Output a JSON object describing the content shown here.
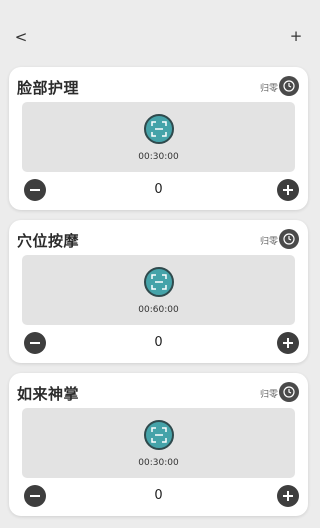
{
  "nav": {
    "back_label": "<",
    "add_label": "+"
  },
  "cards": [
    {
      "title": "脸部护理",
      "reset_label": "归零",
      "time": "00:30:00",
      "count": "0"
    },
    {
      "title": "穴位按摩",
      "reset_label": "归零",
      "time": "00:60:00",
      "count": "0"
    },
    {
      "title": "如来神掌",
      "reset_label": "归零",
      "time": "00:30:00",
      "count": "0"
    }
  ],
  "icons": {
    "back": "chevron-left-icon",
    "add": "plus-icon",
    "reset": "reset-icon",
    "scan": "scan-icon",
    "minus": "minus-icon",
    "plus": "plus-icon"
  },
  "colors": {
    "background": "#ececec",
    "card": "#ffffff",
    "display": "#e3e3e3",
    "accent": "#45a3a9",
    "button": "#3e3e3e"
  }
}
